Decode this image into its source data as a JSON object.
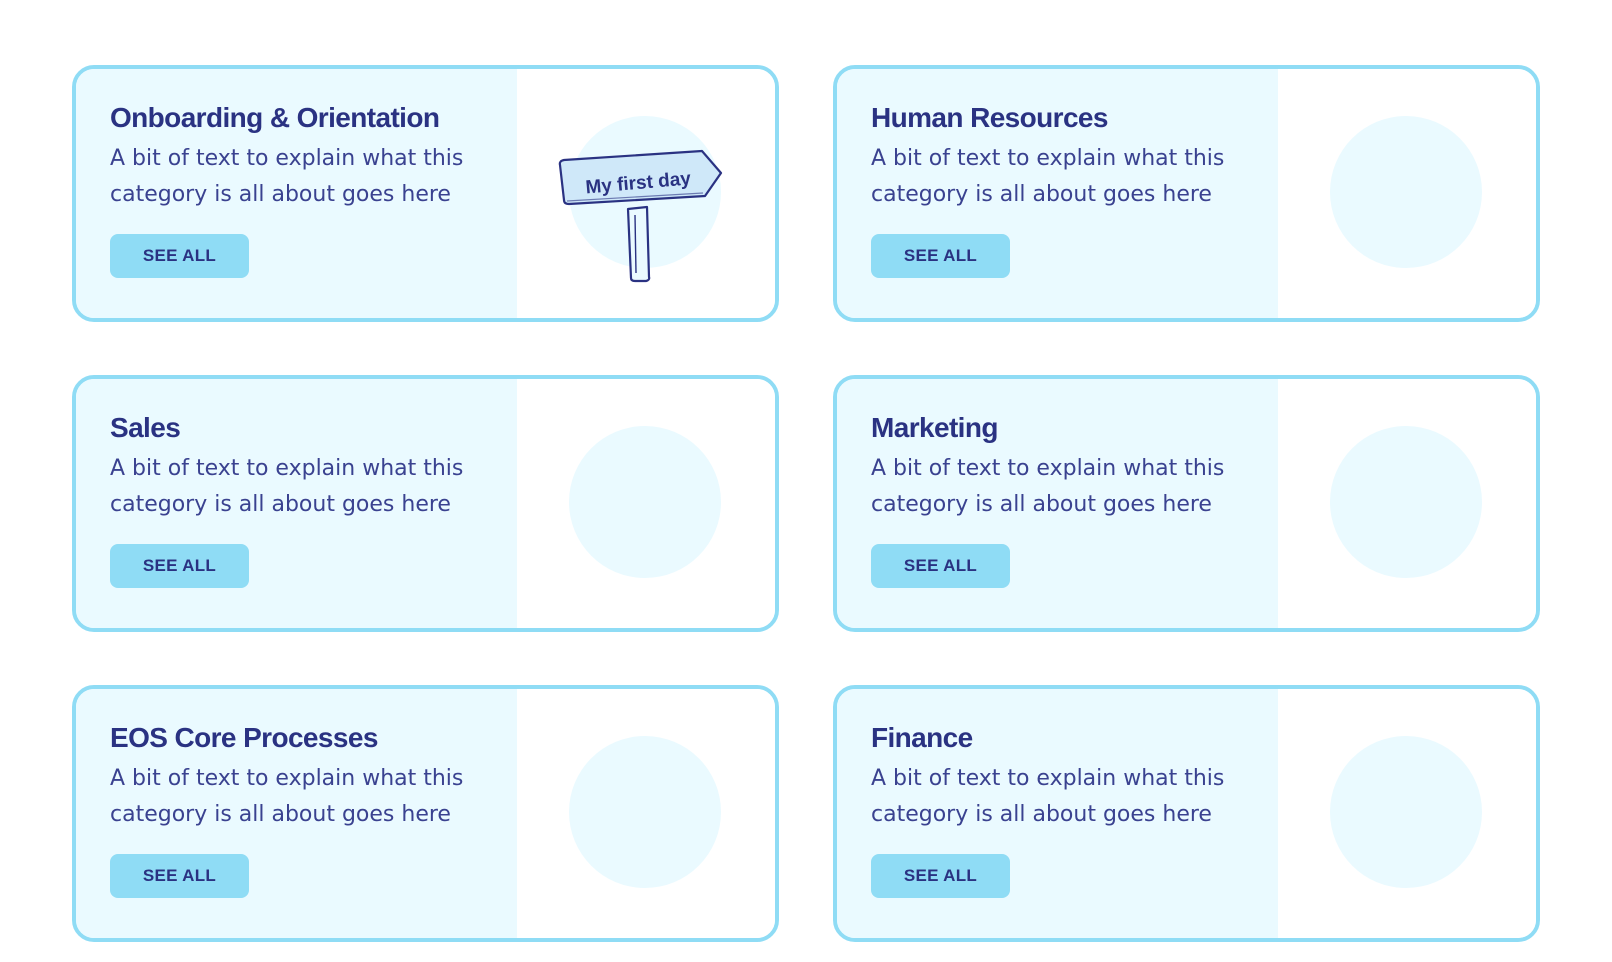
{
  "categories": [
    {
      "title": "Onboarding & Orientation",
      "description": "A bit of text to explain what this category is all about goes here",
      "button_label": "SEE ALL",
      "illustration": "signpost-icon",
      "sign_text": "My first day"
    },
    {
      "title": "Human Resources",
      "description": "A bit of text to explain what this category is all about goes here",
      "button_label": "SEE ALL"
    },
    {
      "title": "Sales",
      "description": "A bit of text to explain what this category is all about goes here",
      "button_label": "SEE ALL"
    },
    {
      "title": "Marketing",
      "description": "A bit of text to explain what this category is all about goes here",
      "button_label": "SEE ALL"
    },
    {
      "title": "EOS Core Processes",
      "description": "A bit of text to explain what this category is all about goes here",
      "button_label": "SEE ALL"
    },
    {
      "title": "Finance",
      "description": "A bit of text to explain what this category is all about goes here",
      "button_label": "SEE ALL"
    }
  ],
  "colors": {
    "border": "#8fdcf5",
    "panel_background": "#eafaff",
    "button_background": "#8fdcf5",
    "text_primary": "#2a3282"
  }
}
